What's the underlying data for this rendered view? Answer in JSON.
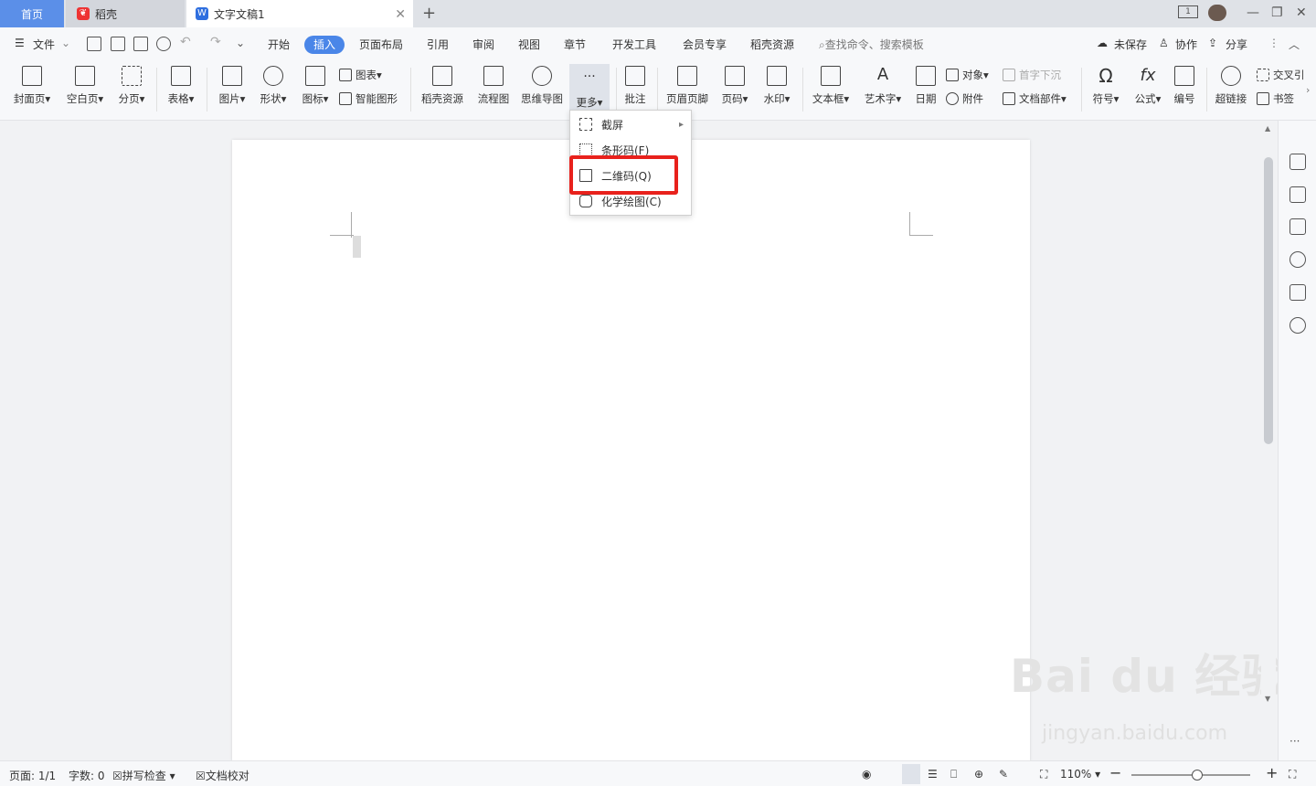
{
  "tabs": {
    "home": "首页",
    "daoke": "稻壳",
    "doc": "文字文稿1"
  },
  "menubar": {
    "file": "文件",
    "items": [
      "开始",
      "插入",
      "页面布局",
      "引用",
      "审阅",
      "视图",
      "章节",
      "开发工具",
      "会员专享",
      "稻壳资源"
    ],
    "search": "查找命令、搜索模板",
    "unsaved": "未保存",
    "collab": "协作",
    "share": "分享"
  },
  "ribbon": {
    "cover": "封面页",
    "blank": "空白页",
    "pagebreak": "分页",
    "table": "表格",
    "picture": "图片",
    "shape": "形状",
    "icon": "图标",
    "chart": "图表",
    "smartart": "智能图形",
    "daoke_res": "稻壳资源",
    "flow": "流程图",
    "mindmap": "思维导图",
    "more": "更多",
    "comment": "批注",
    "header": "页眉页脚",
    "pagenum": "页码",
    "watermark": "水印",
    "textbox": "文本框",
    "wordart": "艺术字",
    "date": "日期",
    "object": "对象",
    "attach": "附件",
    "dropcap": "首字下沉",
    "docpart": "文档部件",
    "symbol": "符号",
    "formula": "公式",
    "numbering": "编号",
    "hyperlink": "超链接",
    "crossref": "交叉引",
    "bookmark": "书签"
  },
  "dropdown": {
    "screenshot": "截屏",
    "barcode": "条形码(F)",
    "qrcode": "二维码(Q)",
    "chem": "化学绘图(C)"
  },
  "status": {
    "page": "页面: 1/1",
    "words": "字数: 0",
    "spell": "拼写检查",
    "proof": "文档校对",
    "zoom": "110%",
    "zoom_fraction": 0.55
  },
  "watermark": {
    "main": "Bai du 经验",
    "sub": "jingyan.baidu.com"
  },
  "colors": {
    "accent": "#4a86e8",
    "highlight": "#e8211c"
  }
}
